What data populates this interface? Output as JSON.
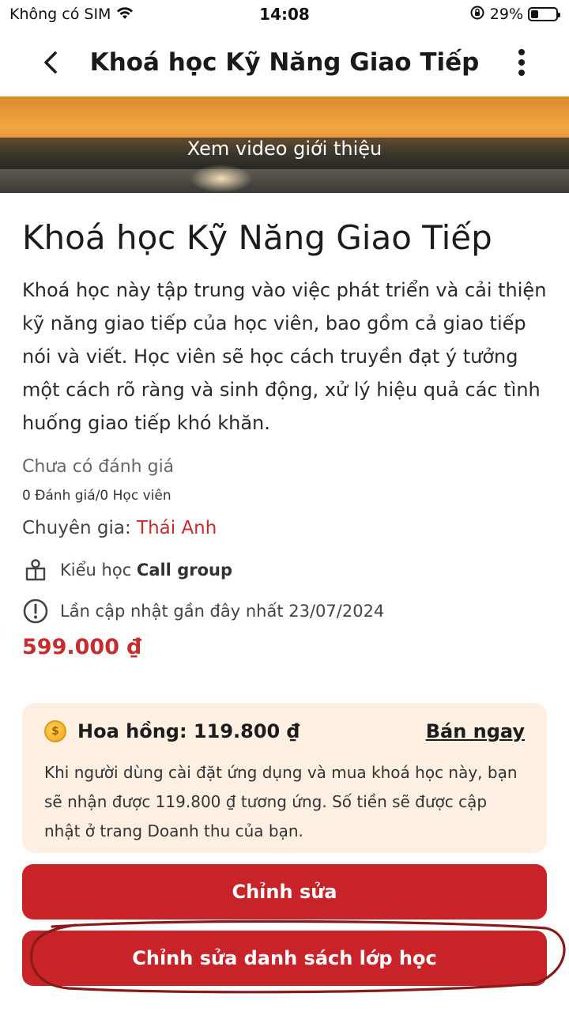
{
  "status_bar": {
    "carrier": "Không có SIM",
    "time": "14:08",
    "battery_percent": "29%",
    "battery_level": 0.29
  },
  "header": {
    "title": "Khoá học Kỹ Năng Giao Tiếp",
    "back_icon": "chevron-left-icon",
    "more_icon": "more-vertical-icon"
  },
  "banner": {
    "label": "Xem video giới thiệu"
  },
  "course": {
    "title": "Khoá học Kỹ Năng Giao Tiếp",
    "description": "Khoá học này tập trung vào việc phát triển và cải thiện kỹ năng giao tiếp của học viên, bao gồm cả giao tiếp nói và viết. Học viên sẽ học cách truyền đạt ý tưởng một cách rõ ràng và sinh động, xử lý hiệu quả các tình huống giao tiếp khó khăn.",
    "rating_text": "Chưa có đánh giá",
    "rating_count": "0 Đánh giá/0 Học viên",
    "expert_label": "Chuyên gia:",
    "expert_name": "Thái Anh",
    "study_type_label": "Kiểu học",
    "study_type_value": "Call group",
    "last_update": "Lần cập nhật gần đây nhất 23/07/2024",
    "price": "599.000 ₫"
  },
  "commission": {
    "label": "Hoa hồng: 119.800 ₫",
    "sell_now": "Bán ngay",
    "text": "Khi người dùng cài đặt ứng dụng và mua khoá học này, bạn sẽ nhận được 119.800 ₫ tương ứng. Số tiền sẽ được cập nhật ở trang Doanh thu của bạn."
  },
  "buttons": {
    "edit": "Chỉnh sửa",
    "edit_class_list": "Chỉnh sửa danh sách lớp học"
  },
  "colors": {
    "accent": "#c9232a",
    "expert_name": "#c62d2f",
    "commission_bg": "#fdf0e3",
    "annotation": "#8a1a1a"
  }
}
